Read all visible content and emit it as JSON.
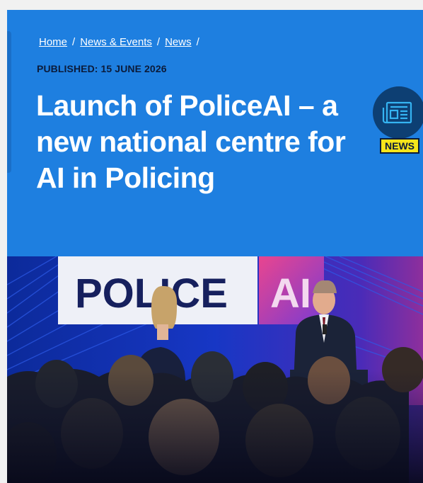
{
  "breadcrumb": {
    "items": [
      "Home",
      "News & Events",
      "News"
    ],
    "separator": "/"
  },
  "published": "PUBLISHED: 15 JUNE 2026",
  "title": "Launch of PoliceAI – a new national centre for AI in Policing",
  "badge": {
    "label": "NEWS",
    "icon": "newspaper-icon"
  },
  "photo": {
    "banner_text": "POLICE",
    "banner_text_2": "AI"
  },
  "colors": {
    "hero_blue": "#1e7fe0",
    "badge_yellow": "#f6e51a",
    "badge_circle": "#0d3f73",
    "text_dark": "#0b1b3a"
  }
}
